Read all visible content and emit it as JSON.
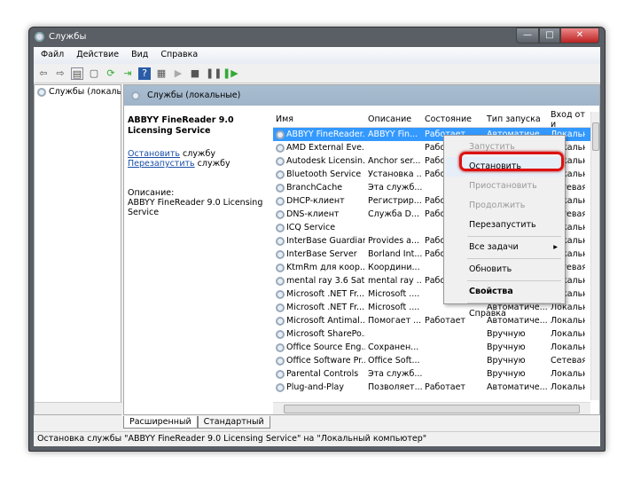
{
  "window": {
    "title": "Службы",
    "min": "—",
    "max": "□",
    "close": "✕"
  },
  "menu": [
    "Файл",
    "Действие",
    "Вид",
    "Справка"
  ],
  "tree": {
    "item": "Службы (локалы"
  },
  "band": {
    "title": "Службы (локальные)"
  },
  "detail": {
    "name": "ABBYY FineReader 9.0 Licensing Service",
    "stop_link": "Остановить",
    "stop_suffix": " службу",
    "restart_link": "Перезапустить",
    "restart_suffix": " службу",
    "desc_label": "Описание:",
    "desc": "ABBYY FineReader 9.0 Licensing Service"
  },
  "columns": [
    "Имя",
    "Описание",
    "Состояние",
    "Тип запуска",
    "Вход от и"
  ],
  "rows": [
    {
      "name": "ABBYY FineReader...",
      "desc": "ABBYY Fin...",
      "state": "Работает",
      "type": "Автоматиче...",
      "logon": "Локальна"
    },
    {
      "name": "AMD External Eve...",
      "desc": "",
      "state": "Работает",
      "type": "",
      "logon": "Локальна"
    },
    {
      "name": "Autodesk Licensin...",
      "desc": "Anchor ser...",
      "state": "Работает",
      "type": "",
      "logon": "Локальна"
    },
    {
      "name": "Bluetooth Service",
      "desc": "Установка ...",
      "state": "Работает",
      "type": "",
      "logon": "Локальна"
    },
    {
      "name": "BranchCache",
      "desc": "Эта служб...",
      "state": "",
      "type": "",
      "logon": "Сетевая"
    },
    {
      "name": "DHCP-клиент",
      "desc": "Регистрир...",
      "state": "Работает",
      "type": "",
      "logon": "Локальна"
    },
    {
      "name": "DNS-клиент",
      "desc": "Служба D...",
      "state": "Работает",
      "type": "",
      "logon": "Сетевая"
    },
    {
      "name": "ICQ Service",
      "desc": "",
      "state": "",
      "type": "",
      "logon": "Локальна"
    },
    {
      "name": "InterBase Guardian",
      "desc": "Provides a...",
      "state": "Работает",
      "type": "",
      "logon": "Локальна"
    },
    {
      "name": "InterBase Server",
      "desc": "Borland Int...",
      "state": "Работает",
      "type": "",
      "logon": "Локальна"
    },
    {
      "name": "KtmRm для коор...",
      "desc": "Координи...",
      "state": "",
      "type": "",
      "logon": "Сетевая"
    },
    {
      "name": "mental ray 3.6 Sat...",
      "desc": "mental ray ...",
      "state": "Работает",
      "type": "",
      "logon": "Локальна"
    },
    {
      "name": "Microsoft .NET Fr...",
      "desc": "Microsoft ....",
      "state": "",
      "type": "",
      "logon": "Локальна"
    },
    {
      "name": "Microsoft .NET Fr...",
      "desc": "Microsoft ....",
      "state": "",
      "type": "Автоматиче...",
      "logon": "Локальна"
    },
    {
      "name": "Microsoft Antimal...",
      "desc": "Помогает ...",
      "state": "Работает",
      "type": "Автоматиче...",
      "logon": "Локальна"
    },
    {
      "name": "Microsoft SharePo...",
      "desc": "",
      "state": "",
      "type": "Вручную",
      "logon": "Локальна"
    },
    {
      "name": "Office  Source Eng...",
      "desc": "Сохранен...",
      "state": "",
      "type": "Вручную",
      "logon": "Локальна"
    },
    {
      "name": "Office Software Pr...",
      "desc": "Office Soft...",
      "state": "",
      "type": "Вручную",
      "logon": "Сетевая"
    },
    {
      "name": "Parental Controls",
      "desc": "Эта служб...",
      "state": "",
      "type": "Вручную",
      "logon": "Локальна"
    },
    {
      "name": "Plug-and-Play",
      "desc": "Позволяет...",
      "state": "Работает",
      "type": "Автоматиче...",
      "logon": "Локальна"
    }
  ],
  "context_menu": {
    "start": "Запустить",
    "stop": "Остановить",
    "pause": "Приостановить",
    "resume": "Продолжить",
    "restart": "Перезапустить",
    "all_tasks": "Все задачи",
    "refresh": "Обновить",
    "properties": "Свойства",
    "help": "Справка"
  },
  "tabs": [
    "Расширенный",
    "Стандартный"
  ],
  "status": "Остановка службы \"ABBYY FineReader 9.0 Licensing Service\" на \"Локальный компьютер\""
}
